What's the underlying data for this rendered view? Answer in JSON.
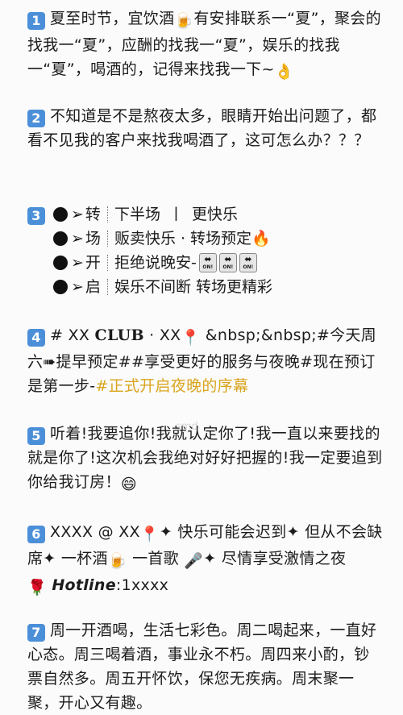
{
  "p1": {
    "num": "1",
    "a": "夏至时节，宜饮酒",
    "beer_icon": "🍺",
    "b": "有安排联系一“夏”，聚会的找我一“夏”，应酬的找我一“夏”，娱乐的找我一“夏”，喝酒的，记得来找我一下~",
    "ok_icon": "👌"
  },
  "p2": {
    "num": "2",
    "text": "不知道是不是熬夜太多，眼睛开始出问题了，都看不见我的客户来找我喝酒了，这可怎么办？？？"
  },
  "p3": {
    "num": "3",
    "rows": [
      {
        "key": "转",
        "text": "下半场",
        "pipe": "丨",
        "text2": "更快乐"
      },
      {
        "key": "场",
        "text": "贩卖快乐 · 转场预定",
        "icon": "🔥"
      },
      {
        "key": "开",
        "text": "拒绝说晚安-",
        "on_label": "ON!"
      },
      {
        "key": "启",
        "text": "娱乐不间断 转场更精彩"
      }
    ],
    "arrow": "➢"
  },
  "p4": {
    "num": "4",
    "a": "# XX ",
    "club": "CLUB",
    "b": " · XX",
    "pin_icon": "📍",
    "c": " &nbsp;&nbsp;#今天周六➠提早预定##享受更好的服务与夜晚#现在预订是第一步-",
    "highlight": "#正式开启夜晚的序幕"
  },
  "p5": {
    "num": "5",
    "text": "听着!我要追你!我就认定你了!我一直以来要找的就是你了!这次机会我绝对好好把握的!我一定要追到你给我订房！",
    "smile_icon": "😄",
    "watermark": "smd"
  },
  "p6": {
    "num": "6",
    "a": "XXXX @ XX",
    "pin_icon": "📍",
    "b": "✦ 快乐可能会迟到✦ 但从不会缺席✦ 一杯酒",
    "beer_icon": "🍺",
    "c": " 一首歌 ",
    "mic_icon": "🎤",
    "d": "✦ 尽情享受激情之夜",
    "rose_icon": "🌹",
    "hotline_label": "Hotline",
    "hotline_value": ":1xxxx"
  },
  "p7": {
    "num": "7",
    "text": "周一开酒喝，生活七彩色。周二喝起来，一直好心态。周三喝着酒，事业永不朽。周四来小酌，钞票自然多。周五开怀饮，保您无疾病。周末聚一聚，开心又有趣。"
  },
  "colors": {
    "keycap": "#4c8fd9",
    "highlight": "#d9a51e"
  }
}
